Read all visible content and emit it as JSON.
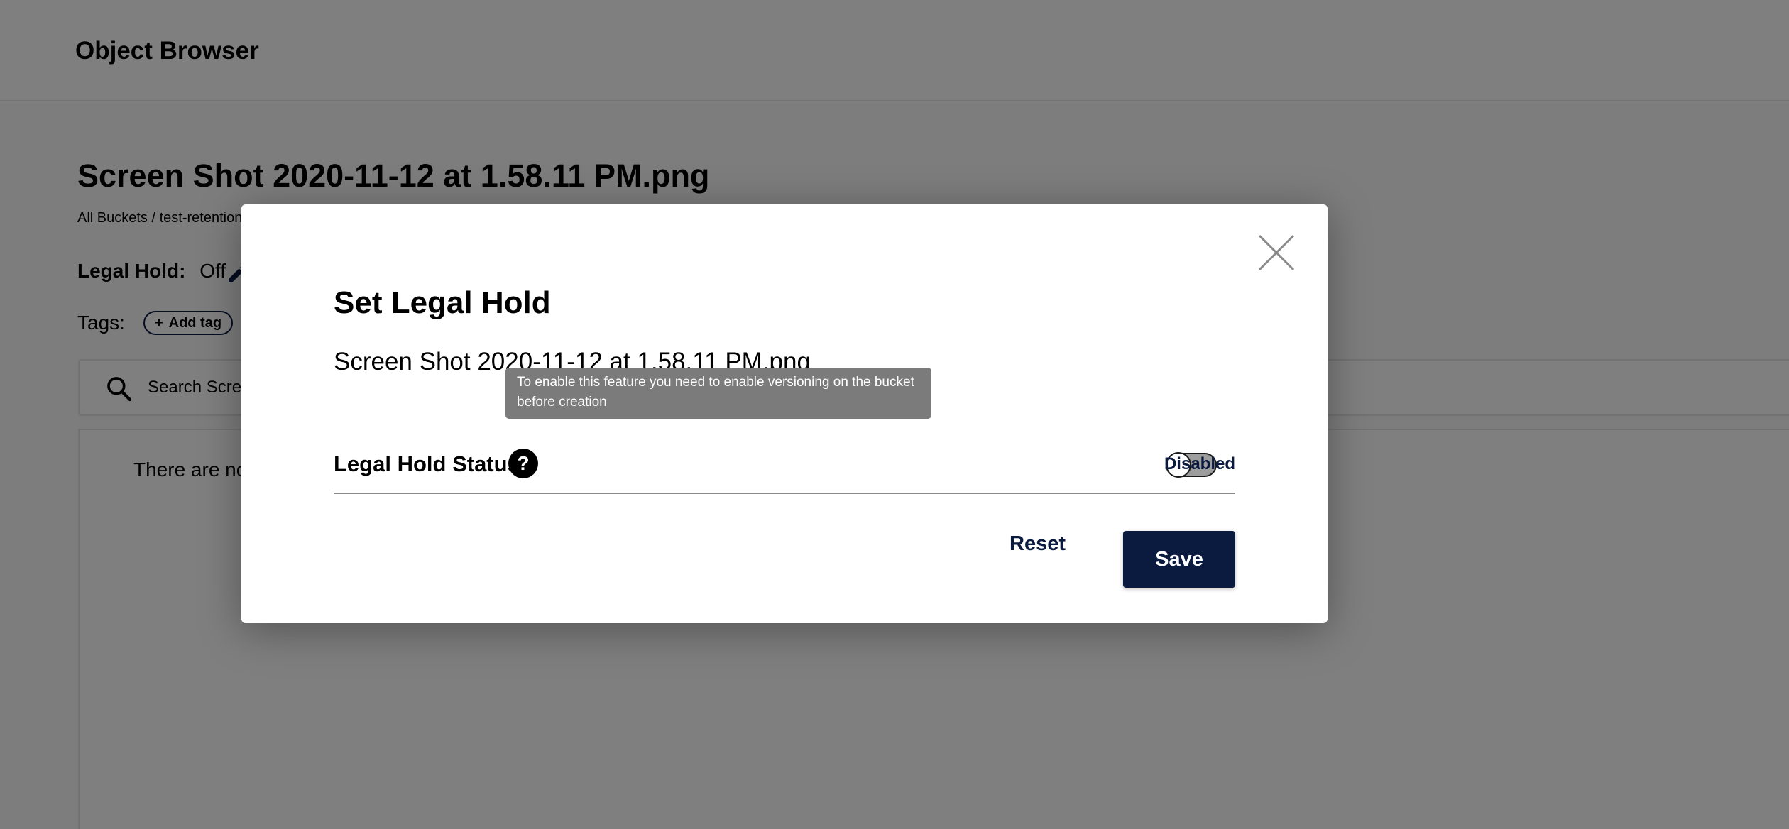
{
  "app": {
    "title": "Object Browser"
  },
  "object": {
    "title": "Screen Shot 2020-11-12 at 1.58.11 PM.png",
    "breadcrumb": "All Buckets / test-retention"
  },
  "legal_hold": {
    "label": "Legal Hold:",
    "value": "Off"
  },
  "tags": {
    "label": "Tags:",
    "add_label": "Add tag"
  },
  "search": {
    "placeholder": "Search Scree"
  },
  "list": {
    "empty_text": "There are no"
  },
  "modal": {
    "title": "Set Legal Hold",
    "filename": "Screen Shot 2020-11-12 at 1.58.11 PM.png",
    "status_label": "Legal Hold Status",
    "toggle_state": "Disabled",
    "reset_label": "Reset",
    "save_label": "Save",
    "tooltip": "To enable this feature you need to enable versioning on the bucket before creation"
  },
  "colors": {
    "primary": "#0b1b3f",
    "overlay": "rgba(0,0,0,0.5)",
    "tooltip_bg": "#7b7b7b",
    "toggle_off": "#9e9e9e"
  },
  "icons": [
    "edit-icon",
    "search-icon",
    "plus-icon",
    "close-icon",
    "help-icon"
  ]
}
